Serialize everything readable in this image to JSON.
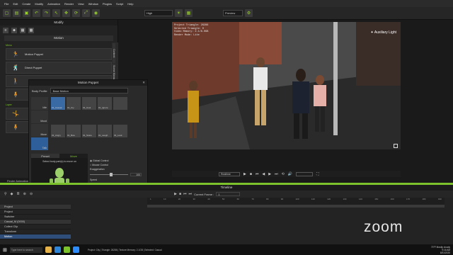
{
  "menu": [
    "File",
    "Edit",
    "Create",
    "Modify",
    "Animation",
    "Render",
    "View",
    "Window",
    "Plugins",
    "Script",
    "Help"
  ],
  "toolbar": {
    "quality": "High",
    "preview": "Preview",
    "icons": [
      "new-icon",
      "open-icon",
      "save-icon",
      "undo-icon",
      "redo-icon",
      "select-icon",
      "move-icon",
      "rotate-icon",
      "scale-icon",
      "camera-icon"
    ]
  },
  "left_panel": {
    "title": "Modify",
    "motion_title": "Motion",
    "section_label": "Menu",
    "section_label2": "Layer",
    "rows": [
      "Motion Puppet",
      "Direct Puppet",
      "",
      "",
      "",
      "",
      ""
    ],
    "footer": "Finder Animation"
  },
  "vtabs": [
    "Content",
    "Scene Manager"
  ],
  "viewport": {
    "info_lines": [
      "Project Triangle: 26286",
      "Selected Triangle: 0",
      "Video Memory: 2.1/8.0GB",
      "Render Mode: Lite"
    ],
    "light_label": "Auxiliary Light"
  },
  "playbar": {
    "mode": "Realtime"
  },
  "puppet": {
    "title": "Motion Puppet",
    "body_profile_label": "Body Profile",
    "body_profile_value": "Base Motion",
    "categories": [
      "Idle",
      "Mood",
      "Move",
      "Talk"
    ],
    "thumbs": [
      "01_Casual",
      "01_Cry",
      "01_Cool",
      "01_Ignore",
      "",
      "01_Angry",
      "01_Bow",
      "01_Scare",
      "01_Laugh",
      "01_Look"
    ],
    "tabs": [
      "Preset",
      "Move"
    ],
    "stage_hint": "Select body part(s) to move on",
    "radio1": "Global Control",
    "radio2": "Mouse Control",
    "exaggeration_label": "Exaggeration",
    "exaggeration_value": "100",
    "speed_label": "Speed",
    "speed_value": "100",
    "preview_label": "Preview",
    "record_label": "Record"
  },
  "timeline": {
    "title": "Timeline",
    "current_frame_label": "Current Frame :",
    "current_frame_value": "1",
    "ruler_ticks": [
      "1",
      "10",
      "20",
      "30",
      "40",
      "50",
      "60",
      "70",
      "80",
      "90",
      "100",
      "110",
      "120",
      "130",
      "140",
      "150",
      "160",
      "170",
      "180",
      "190"
    ],
    "tracks": [
      {
        "label": "Project",
        "style": "hdr"
      },
      {
        "label": "Project",
        "style": ""
      },
      {
        "label": "Switcher",
        "style": ""
      },
      {
        "label": "Casual_M (0000)",
        "style": "hdr"
      },
      {
        "label": "Collect Clip",
        "style": ""
      },
      {
        "label": "Transform",
        "style": ""
      },
      {
        "label": "Motion",
        "style": "sel"
      }
    ]
  },
  "zoom_watermark": "zoom",
  "statusbar": {
    "search_placeholder": "Type here to search",
    "status_text": "Project: City  |  Triangle: 26286  |  Texture Memory: 2.1GB  |  Selected: Casual",
    "tray_time": "9:16 AM",
    "tray_date": "8/31/2020",
    "tray_weather": "70°F Mostly cloudy"
  },
  "colors": {
    "accent": "#7cc22c",
    "selection": "#2f5f9a",
    "record": "#e02020"
  }
}
